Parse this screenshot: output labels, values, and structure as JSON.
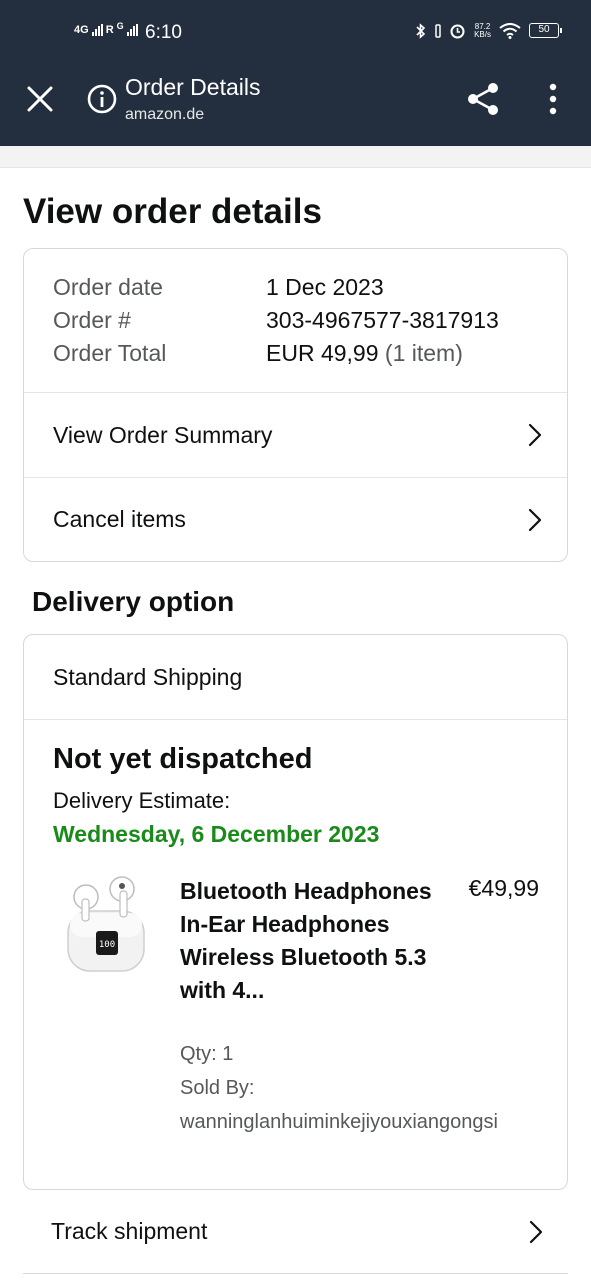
{
  "status_bar": {
    "network_left": "4G",
    "network_right": "R",
    "network_small": "G",
    "time": "6:10",
    "speed_value": "87.2",
    "speed_unit": "KB/s",
    "battery": "50",
    "icons": [
      "bluetooth-icon",
      "vibrate-icon",
      "alarm-icon",
      "wifi-icon",
      "battery-icon"
    ]
  },
  "header": {
    "title": "Order Details",
    "subtitle": "amazon.de",
    "icons": [
      "close-icon",
      "info-icon",
      "share-icon",
      "more-vert-icon"
    ],
    "background": "#232f3e"
  },
  "page": {
    "title": "View order details"
  },
  "order_info": {
    "rows": [
      {
        "label": "Order date",
        "value": "1 Dec 2023"
      },
      {
        "label": "Order #",
        "value": "303-4967577-3817913"
      },
      {
        "label": "Order Total",
        "value": "EUR 49,99",
        "suffix": "(1 item)"
      }
    ],
    "links": [
      "View Order Summary",
      "Cancel items"
    ]
  },
  "delivery": {
    "section_title": "Delivery option",
    "shipping_method": "Standard Shipping",
    "status": "Not yet dispatched",
    "estimate_label": "Delivery Estimate:",
    "estimate_date": "Wednesday, 6 December 2023",
    "estimate_color": "#1a8a1a",
    "product": {
      "title": "Bluetooth Headphones In-Ear Headphones Wireless Bluetooth 5.3 with 4...",
      "price": "€49,99",
      "qty": "Qty: 1",
      "sold_by_label": "Sold By:",
      "seller": "wanninglanhuiminkejiyouxiangongsi",
      "image_icon": "earbuds-product-image"
    }
  },
  "track": {
    "label": "Track shipment"
  }
}
